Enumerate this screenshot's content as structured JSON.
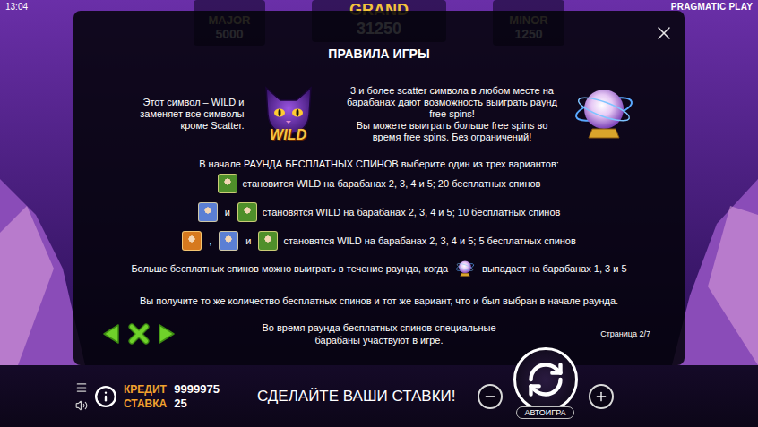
{
  "status_bar": {
    "time": "13:04",
    "brand": "PRAGMATIC PLAY"
  },
  "jackpots": [
    {
      "label": "MAJOR",
      "value": "5000",
      "kind": "side"
    },
    {
      "label": "GRAND",
      "value": "31250",
      "kind": "main"
    },
    {
      "label": "MINOR",
      "value": "1250",
      "kind": "side"
    }
  ],
  "rules": {
    "title": "ПРАВИЛА ИГРЫ",
    "wild": {
      "text": "Этот символ – WILD и заменяет все символы кроме Scatter.",
      "badge": "WILD"
    },
    "scatter": {
      "lines": [
        "3 и более scatter символа в любом месте на барабанах дают возможность выиграть раунд free spins!",
        "Вы можете выиграть больше free spins во время free spins. Без ограничений!"
      ]
    },
    "options_intro": "В начале РАУНДА БЕСПЛАТНЫХ СПИНОВ выберите один из трех вариантов:",
    "options": [
      {
        "symbols": [
          {
            "color": "#4f8f2a"
          }
        ],
        "separators": [],
        "text": "становится WILD на барабанах 2, 3, 4 и 5; 20 бесплатных спинов"
      },
      {
        "symbols": [
          {
            "color": "#5b7fd4"
          },
          {
            "color": "#4f8f2a"
          }
        ],
        "separators": [
          "и"
        ],
        "text": "становятся WILD на барабанах 2, 3, 4 и 5; 10 бесплатных спинов"
      },
      {
        "symbols": [
          {
            "color": "#d6791e"
          },
          {
            "color": "#5b7fd4"
          },
          {
            "color": "#4f8f2a"
          }
        ],
        "separators": [
          ",",
          "и"
        ],
        "text": "становятся WILD на барабанах 2, 3, 4 и 5; 5 бесплатных спинов"
      }
    ],
    "retrigger": {
      "before": "Больше бесплатных спинов можно выиграть в течение раунда, когда",
      "after": "выпадает на барабанах 1, 3 и 5"
    },
    "same_option": "Вы получите то же количество бесплатных спинов и тот же вариант, что и был выбран в начале раунда.",
    "special_reels": "Во время раунда бесплатных спинов специальные барабаны участвуют в игре.",
    "page": "Страница 2/7"
  },
  "bottom_bar": {
    "credit_label": "КРЕДИТ",
    "credit": "9999975",
    "bet_label": "СТАВКА",
    "bet": "25",
    "message": "СДЕЛАЙТЕ ВАШИ СТАВКИ!",
    "autoplay": "АВТОИГРА"
  }
}
